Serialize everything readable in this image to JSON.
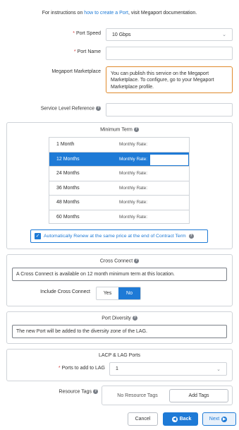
{
  "intro": {
    "prefix": "For instructions on ",
    "link": "how to create a Port",
    "suffix": ", visit Megaport documentation."
  },
  "port_speed": {
    "label": "Port Speed",
    "value": "10 Gbps"
  },
  "port_name": {
    "label": "Port Name",
    "value": ""
  },
  "marketplace": {
    "label": "Megaport Marketplace",
    "notice": "You can publish this service on the Megaport Marketplace. To configure, go to your Megaport Marketplace profile."
  },
  "service_level_reference": {
    "label": "Service Level Reference",
    "value": ""
  },
  "minimum_term": {
    "title": "Minimum Term",
    "rate_label": "Monthly Rate:",
    "terms": [
      {
        "label": "1 Month",
        "selected": false
      },
      {
        "label": "12 Months",
        "selected": true
      },
      {
        "label": "24 Months",
        "selected": false
      },
      {
        "label": "36 Months",
        "selected": false
      },
      {
        "label": "48 Months",
        "selected": false
      },
      {
        "label": "60 Months",
        "selected": false
      }
    ],
    "auto_renew_label": "Automatically Renew at the same price at the end of Contract Term",
    "auto_renew_checked": true
  },
  "cross_connect": {
    "title": "Cross Connect",
    "message": "A Cross Connect is available on 12 month minimum term at this location.",
    "include_label": "Include Cross Connect",
    "yes_label": "Yes",
    "no_label": "No",
    "selected": "No"
  },
  "port_diversity": {
    "title": "Port Diversity",
    "message": "The new Port will be added to the diversity zone of the LAG."
  },
  "lacp": {
    "title": "LACP & LAG Ports",
    "ports_label": "Ports to add to LAG",
    "ports_value": "1"
  },
  "resource_tags": {
    "label": "Resource Tags",
    "empty_text": "No Resource Tags",
    "add_label": "Add Tags"
  },
  "footer": {
    "cancel_label": "Cancel",
    "back_label": "Back",
    "next_label": "Next"
  },
  "colors": {
    "accent": "#1e7ad6",
    "required": "#d23b3b",
    "notice_border": "#e08a2c"
  }
}
